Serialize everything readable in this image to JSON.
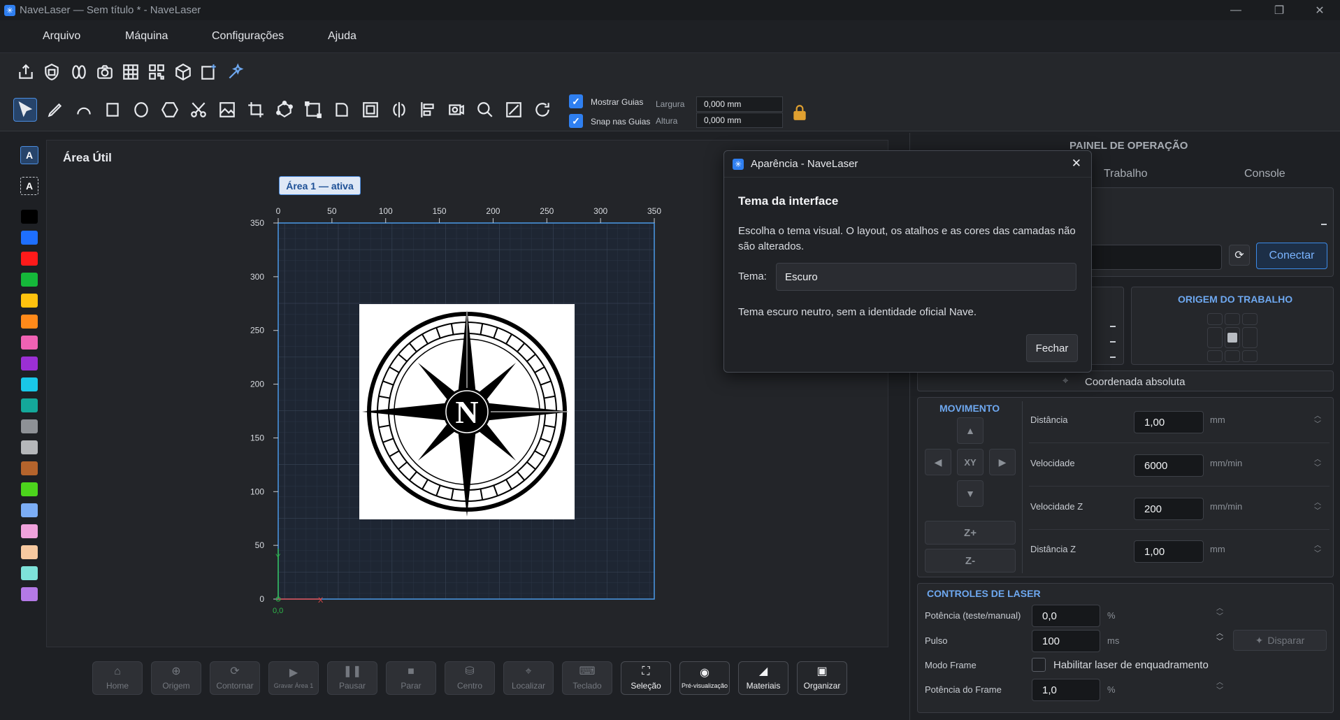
{
  "window": {
    "title": "NaveLaser — Sem título * - NaveLaser"
  },
  "menu": [
    "Arquivo",
    "Máquina",
    "Configurações",
    "Ajuda"
  ],
  "toolbar2": {
    "show_guides": "Mostrar Guias",
    "snap_guides": "Snap nas Guias",
    "width_label": "Largura",
    "height_label": "Altura",
    "width_value": "0,000 mm",
    "height_value": "0,000 mm"
  },
  "layer_colors": [
    "#000000",
    "#1e6fff",
    "#ff1a1a",
    "#15b83a",
    "#ffc20e",
    "#ff8a1a",
    "#f062b4",
    "#9b2fd4",
    "#19c7e8",
    "#14a89a",
    "#8e9196",
    "#b5b7ba",
    "#b5642c",
    "#4cd41c",
    "#7cadf5",
    "#f0a2dc",
    "#f7c9a0",
    "#7ee2d9",
    "#b479e6"
  ],
  "canvas": {
    "title": "Área Útil",
    "active_area": "Área 1 — ativa",
    "x_ticks": [
      "0",
      "50",
      "100",
      "150",
      "200",
      "250",
      "300",
      "350"
    ],
    "y_ticks": [
      "350",
      "300",
      "250",
      "200",
      "150",
      "100",
      "50",
      "0"
    ],
    "origin_label": "0,0",
    "axis_x": "X",
    "axis_y": "Y",
    "logo_letter": "N"
  },
  "bottom_buttons": [
    {
      "label": "Home",
      "icon": "⌂"
    },
    {
      "label": "Origem",
      "icon": "⊕"
    },
    {
      "label": "Contornar",
      "icon": "⟳"
    },
    {
      "label": "Gravar Área 1",
      "icon": "▶"
    },
    {
      "label": "Pausar",
      "icon": "❚❚"
    },
    {
      "label": "Parar",
      "icon": "■"
    },
    {
      "label": "Centro",
      "icon": "⛁"
    },
    {
      "label": "Localizar",
      "icon": "⌖"
    },
    {
      "label": "Teclado",
      "icon": "⌨"
    },
    {
      "label": "Seleção",
      "icon": "⛶"
    },
    {
      "label": "Pré-visualização",
      "icon": "◉"
    },
    {
      "label": "Materiais",
      "icon": "◢"
    },
    {
      "label": "Organizar",
      "icon": "▣"
    }
  ],
  "panel": {
    "title": "PAINEL DE OPERAÇÃO",
    "tabs": [
      "Trabalho",
      "Console"
    ],
    "connect": "Conectar",
    "origin_title": "ORIGEM DO TRABALHO",
    "absolute_coord": "Coordenada absoluta",
    "movement": {
      "title": "MOVIMENTO",
      "xy": "XY",
      "zplus": "Z+",
      "zminus": "Z-",
      "fields": [
        {
          "label": "Distância",
          "value": "1,00",
          "unit": "mm"
        },
        {
          "label": "Velocidade",
          "value": "6000",
          "unit": "mm/min"
        },
        {
          "label": "Velocidade Z",
          "value": "200",
          "unit": "mm/min"
        },
        {
          "label": "Distância Z",
          "value": "1,00",
          "unit": "mm"
        }
      ]
    },
    "laser": {
      "title": "CONTROLES DE LASER",
      "power_label": "Potência (teste/manual)",
      "power_value": "0,0",
      "power_unit": "%",
      "pulse_label": "Pulso",
      "pulse_value": "100",
      "pulse_unit": "ms",
      "fire": "Disparar",
      "frame_mode_label": "Modo Frame",
      "frame_mode_check": "Habilitar laser de enquadramento",
      "frame_power_label": "Potência do Frame",
      "frame_power_value": "1,0",
      "frame_power_unit": "%"
    }
  },
  "dialog": {
    "title": "Aparência - NaveLaser",
    "heading": "Tema da interface",
    "description": "Escolha o tema visual. O layout, os atalhos e as cores das camadas não são alterados.",
    "theme_label": "Tema:",
    "theme_value": "Escuro",
    "note": "Tema escuro neutro, sem a identidade oficial Nave.",
    "close": "Fechar"
  }
}
